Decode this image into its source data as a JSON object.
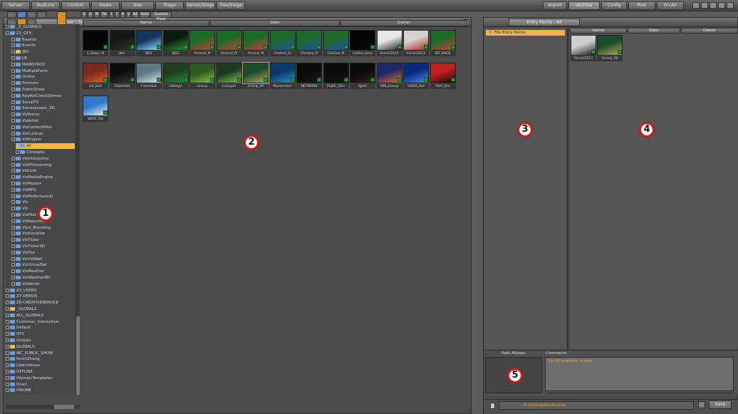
{
  "menu": {
    "left_tabs": [
      "Server",
      "Built-ins",
      "Control",
      "Views",
      "Tree",
      "Stage",
      "Server/Stage",
      "Tree/Stage"
    ],
    "right_tabs": [
      "Import",
      "Archive",
      "Config",
      "Post",
      "On Air"
    ]
  },
  "left_panel": {
    "tab": "Server : Scenes",
    "filters": [
      "S",
      "G",
      "M",
      "FA",
      "I",
      "F",
      "A",
      "V",
      "All",
      "Auto",
      "Guests View"
    ],
    "columns": [
      "Name",
      "Date",
      "Owner"
    ],
    "tree": [
      {
        "label": "_Z_GLOBALS",
        "icon": "folder-icon",
        "color": "blue"
      },
      {
        "label": "Z2_GFX",
        "icon": "folder-icon",
        "color": "blue"
      },
      {
        "label": "Basetw",
        "icon": "folder-icon",
        "color": "blue"
      },
      {
        "label": "Events",
        "icon": "folder-icon",
        "color": "blue"
      },
      {
        "label": "JBU",
        "icon": "folder-icon",
        "color": "yellow"
      },
      {
        "label": "LB",
        "icon": "folder-icon",
        "color": "blue"
      },
      {
        "label": "MAINSTACK",
        "icon": "folder-icon",
        "color": "blue"
      },
      {
        "label": "MultipleForm",
        "icon": "folder-icon",
        "color": "blue"
      },
      {
        "label": "Online",
        "icon": "folder-icon",
        "color": "blue"
      },
      {
        "label": "Partners",
        "icon": "folder-icon",
        "color": "blue"
      },
      {
        "label": "PublicShow",
        "icon": "folder-icon",
        "color": "blue"
      },
      {
        "label": "RealNxCheckDemos",
        "icon": "folder-icon",
        "color": "blue"
      },
      {
        "label": "SocialTV",
        "icon": "folder-icon",
        "color": "blue"
      },
      {
        "label": "Stereoscopic_3D",
        "icon": "folder-icon",
        "color": "blue"
      },
      {
        "label": "VizArena",
        "icon": "folder-icon",
        "color": "blue"
      },
      {
        "label": "VizArtist",
        "icon": "folder-icon",
        "color": "blue"
      },
      {
        "label": "VizContentPilot",
        "icon": "folder-icon",
        "color": "blue"
      },
      {
        "label": "VizCurious",
        "icon": "folder-icon",
        "color": "blue"
      },
      {
        "label": "VizEngine",
        "icon": "folder-icon",
        "color": "blue"
      },
      {
        "label": "All",
        "icon": "folder-icon",
        "color": "blue",
        "selected": true
      },
      {
        "label": "Concepts",
        "icon": "folder-icon",
        "color": "blue"
      },
      {
        "label": "VizInteractive",
        "icon": "folder-icon",
        "color": "blue"
      },
      {
        "label": "VizIPStreaming",
        "icon": "folder-icon",
        "color": "blue"
      },
      {
        "label": "VizLinb",
        "icon": "folder-icon",
        "color": "blue"
      },
      {
        "label": "VizMediaEngine",
        "icon": "folder-icon",
        "color": "blue"
      },
      {
        "label": "VizMosart",
        "icon": "folder-icon",
        "color": "blue"
      },
      {
        "label": "VizMPS",
        "icon": "folder-icon",
        "color": "blue"
      },
      {
        "label": "VizMultichannel",
        "icon": "folder-icon",
        "color": "blue"
      },
      {
        "label": "Viz",
        "icon": "folder-icon",
        "color": "blue"
      },
      {
        "label": "Viz",
        "icon": "folder-icon",
        "color": "blue"
      },
      {
        "label": "VizPilot",
        "icon": "folder-icon",
        "color": "blue"
      },
      {
        "label": "VizReporter",
        "icon": "folder-icon",
        "color": "blue"
      },
      {
        "label": "Vizrt_Branding",
        "icon": "folder-icon",
        "color": "blue"
      },
      {
        "label": "VizSocialize",
        "icon": "folder-icon",
        "color": "blue"
      },
      {
        "label": "VizTicker",
        "icon": "folder-icon",
        "color": "blue"
      },
      {
        "label": "VizTicker3D",
        "icon": "folder-icon",
        "color": "blue"
      },
      {
        "label": "VizTrio",
        "icon": "folder-icon",
        "color": "blue"
      },
      {
        "label": "VizVidWall",
        "icon": "folder-icon",
        "color": "blue"
      },
      {
        "label": "VizVirtualSet",
        "icon": "folder-icon",
        "color": "blue"
      },
      {
        "label": "VizWeather",
        "icon": "folder-icon",
        "color": "blue"
      },
      {
        "label": "VizWeatherIBC",
        "icon": "folder-icon",
        "color": "blue"
      },
      {
        "label": "VizWorld",
        "icon": "folder-icon",
        "color": "blue"
      },
      {
        "label": "X3_USERS",
        "icon": "folder-icon",
        "color": "blue"
      },
      {
        "label": "Z7-DEMOS",
        "icon": "folder-icon",
        "color": "blue"
      },
      {
        "label": "Z8-CREATIVESERVICE",
        "icon": "folder-icon",
        "color": "blue"
      },
      {
        "label": "_GLOBALS",
        "icon": "folder-icon",
        "color": "yellow"
      },
      {
        "label": "ALL_GLOBALS",
        "icon": "folder-icon",
        "color": "blue"
      },
      {
        "label": "Customer_Interactive",
        "icon": "folder-icon",
        "color": "blue"
      },
      {
        "label": "Default",
        "icon": "folder-icon",
        "color": "blue"
      },
      {
        "label": "GFX",
        "icon": "folder-icon",
        "color": "blue"
      },
      {
        "label": "Globals",
        "icon": "folder-icon",
        "color": "blue"
      },
      {
        "label": "GLOBALS",
        "icon": "folder-icon",
        "color": "yellow"
      },
      {
        "label": "IBC_PUBLIC_SHOW",
        "icon": "folder-icon",
        "color": "blue"
      },
      {
        "label": "KevinZhang",
        "icon": "folder-icon",
        "color": "blue"
      },
      {
        "label": "LiberoVenus",
        "icon": "folder-icon",
        "color": "blue"
      },
      {
        "label": "OFFLINE",
        "icon": "folder-icon",
        "color": "blue"
      },
      {
        "label": "OlympicTemplates",
        "icon": "folder-icon",
        "color": "blue"
      },
      {
        "label": "Oneri",
        "icon": "folder-icon",
        "color": "blue"
      },
      {
        "label": "ONLINE",
        "icon": "folder-icon",
        "color": "blue"
      }
    ],
    "scenes": [
      {
        "label": "3_Steps_Ul",
        "colors": [
          "#050505",
          "#0c0c0c"
        ]
      },
      {
        "label": "Bev",
        "colors": [
          "#131a14",
          "#2f3b1f"
        ]
      },
      {
        "label": "BG2",
        "colors": [
          "#13345c",
          "#8ee6ff"
        ]
      },
      {
        "label": "BG3",
        "colors": [
          "#0b1a10",
          "#2f9a32"
        ]
      },
      {
        "label": "Arsenal_Pl",
        "colors": [
          "#1d6b29",
          "#d23b3b"
        ]
      },
      {
        "label": "Arsenal_Pl",
        "colors": [
          "#1d6b29",
          "#d23b3b"
        ]
      },
      {
        "label": "Arsenal_Pl",
        "colors": [
          "#1d6b29",
          "#d23b3b"
        ]
      },
      {
        "label": "Chelsea_Cl",
        "colors": [
          "#1d6b29",
          "#2050b4"
        ]
      },
      {
        "label": "Chelsea_Pl",
        "colors": [
          "#1d6b29",
          "#2050b4"
        ]
      },
      {
        "label": "Chelsea_Pl",
        "colors": [
          "#1d6b29",
          "#2050b4"
        ]
      },
      {
        "label": "Coffee_Scen",
        "colors": [
          "#040404",
          "#0a0a0a"
        ]
      },
      {
        "label": "Ferrari2013",
        "colors": [
          "#e7e7e7",
          "#202020"
        ]
      },
      {
        "label": "Ferrari2013",
        "colors": [
          "#d2d2d2",
          "#b42020"
        ]
      },
      {
        "label": "IBT_BACK",
        "colors": [
          "#1d6b29",
          "#d23b3b"
        ]
      },
      {
        "label": "LIV_B2A",
        "colors": [
          "#7a2b1c",
          "#e35a2d"
        ]
      },
      {
        "label": "Futurehat",
        "colors": [
          "#0b0b0b",
          "#3a3a3a"
        ]
      },
      {
        "label": "Futurehat",
        "colors": [
          "#5a7a86",
          "#d7e6ee"
        ]
      },
      {
        "label": "Lifestyle",
        "colors": [
          "#1b3f1d",
          "#2e8a35"
        ]
      },
      {
        "label": "Lineup",
        "colors": [
          "#2c5a20",
          "#8cc44a"
        ]
      },
      {
        "label": "LineupCl",
        "colors": [
          "#1c3a20",
          "#7ac05a"
        ]
      },
      {
        "label": "Lineup_All",
        "colors": [
          "#1d4d28",
          "#b4a860"
        ]
      },
      {
        "label": "Manchester",
        "colors": [
          "#0b3a6a",
          "#2f8cd2"
        ]
      },
      {
        "label": "NETWORK",
        "colors": [
          "#0a0a0a",
          "#1a1a1a"
        ]
      },
      {
        "label": "Public_Tom",
        "colors": [
          "#0a0a0a",
          "#141414"
        ]
      },
      {
        "label": "Sport",
        "colors": [
          "#0a0a0a",
          "#3a2020"
        ]
      },
      {
        "label": "TNB_Lineup",
        "colors": [
          "#1b2a64",
          "#e86a2a"
        ]
      },
      {
        "label": "VIDEO_Buf",
        "colors": [
          "#0a2a80",
          "#4a8af0"
        ]
      },
      {
        "label": "Vizrt_Sco",
        "colors": [
          "#c22020",
          "#0a0a0a"
        ]
      },
      {
        "label": "WATE_Sw",
        "colors": [
          "#2c7ac8",
          "#e8eef4"
        ]
      }
    ]
  },
  "right_panel": {
    "tab": "Entry Points : All",
    "entry_point": "File Entry Points",
    "columns": [
      "Name",
      "Date",
      "Owner"
    ],
    "thumbs": [
      {
        "label": "Ferrari2013",
        "colors": [
          "#d0d0d0",
          "#1a1a1a"
        ]
      },
      {
        "label": "Lineup_All",
        "colors": [
          "#1d4d28",
          "#b4a860"
        ]
      }
    ],
    "path_alias_label": "Path Aliases",
    "comments_label": "Comments",
    "comment_text": "Viz All example scenes",
    "path_value": "E:\\VizGraphicsScenes",
    "save_label": "Save"
  },
  "callouts": [
    "1",
    "2",
    "3",
    "4",
    "5"
  ]
}
